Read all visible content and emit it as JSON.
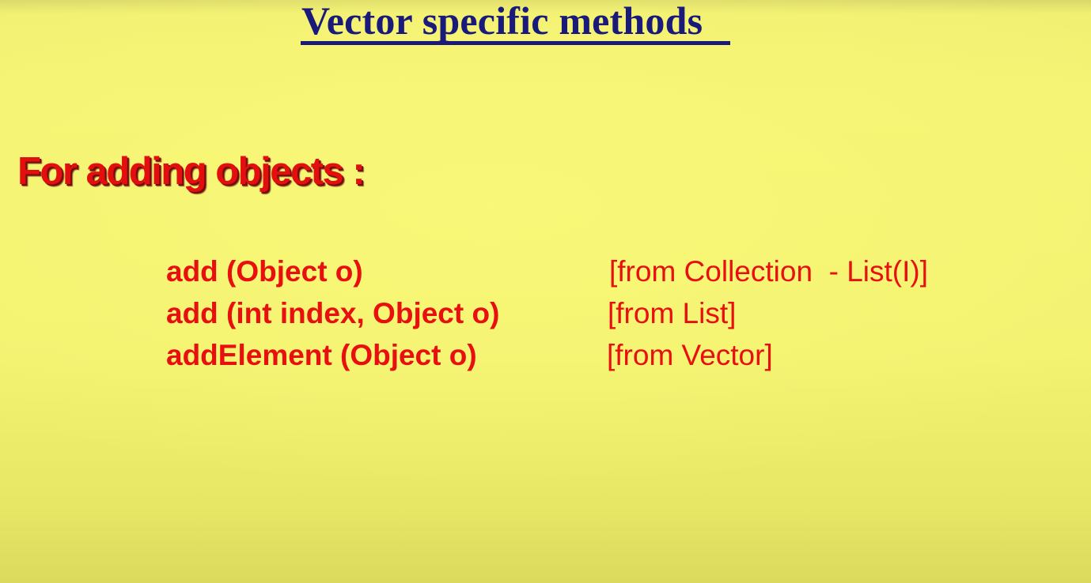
{
  "slide": {
    "title": "Vector specific methods",
    "section_heading": "For adding objects :",
    "methods": [
      {
        "signature": "add (Object o)",
        "source": "[from Collection  - List(I)]"
      },
      {
        "signature": "add (int index, Object o)",
        "source": "[from List]"
      },
      {
        "signature": "addElement (Object o)",
        "source": "[from Vector]"
      }
    ]
  },
  "colors": {
    "background": "#f6f472",
    "title": "#1a1a7a",
    "text_red": "#e80f0f"
  }
}
